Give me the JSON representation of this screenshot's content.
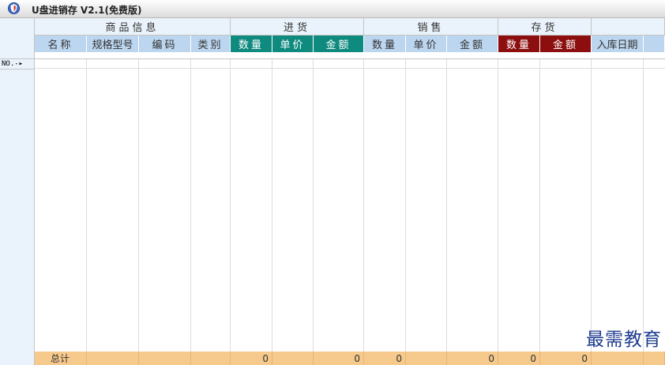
{
  "window": {
    "title": "U盘进销存 V2.1(免费版)",
    "icon": "app-shield-icon"
  },
  "groups": [
    {
      "label": "商品信息"
    },
    {
      "label": "进货"
    },
    {
      "label": "销售"
    },
    {
      "label": "存货"
    }
  ],
  "columns": [
    {
      "label": "名称",
      "color": "#bcd6ef"
    },
    {
      "label": "规格型号",
      "color": "#bcd6ef"
    },
    {
      "label": "编码",
      "color": "#bcd6ef"
    },
    {
      "label": "类别",
      "color": "#bcd6ef"
    },
    {
      "label": "数量",
      "color": "#0f8a7f"
    },
    {
      "label": "单价",
      "color": "#0f8a7f"
    },
    {
      "label": "金额",
      "color": "#0f8a7f"
    },
    {
      "label": "数量",
      "color": "#bcd6ef"
    },
    {
      "label": "单价",
      "color": "#bcd6ef"
    },
    {
      "label": "金额",
      "color": "#bcd6ef"
    },
    {
      "label": "数量",
      "color": "#8c0e0e"
    },
    {
      "label": "金额",
      "color": "#8c0e0e"
    },
    {
      "label": "入库日期",
      "color": "#bcd6ef"
    }
  ],
  "row_indicator": "NO.-▸",
  "footer": {
    "label": "总计",
    "purchase_qty": "0",
    "purchase_amount": "0",
    "sales_qty": "0",
    "sales_amount": "0",
    "stock_qty": "0",
    "stock_amount": "0"
  },
  "watermark": "最需教育",
  "colors": {
    "header_group_bg": "#eaf3fb",
    "footer_bg": "#f6c98c"
  }
}
